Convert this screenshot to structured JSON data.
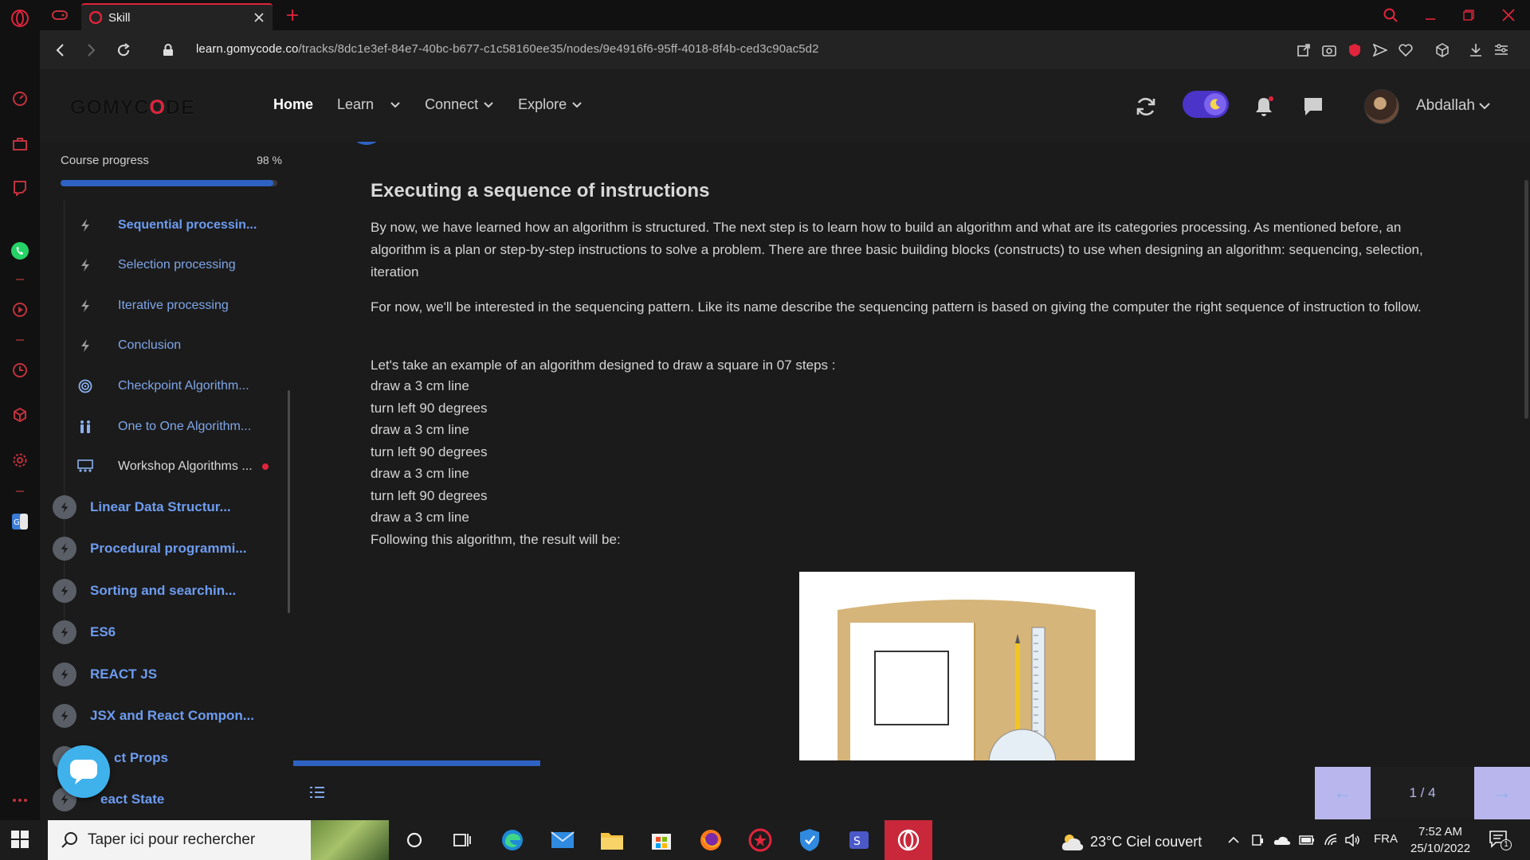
{
  "browser": {
    "tab_title": "Skill",
    "url_host": "learn.gomycode.co",
    "url_path": "/tracks/8dc1e3ef-84e7-40bc-b677-c1c58160ee35/nodes/9e4916f6-95ff-4018-8f4b-ced3c90ac5d2",
    "accent": "#e0243c"
  },
  "header": {
    "logo_pre": "GOMYC",
    "logo_o": "O",
    "logo_post": "DE",
    "nav": [
      {
        "label": "Home"
      },
      {
        "label": "Learn"
      },
      {
        "label": "Connect"
      },
      {
        "label": "Explore"
      }
    ],
    "username": "Abdallah",
    "icons": [
      "refresh-icon",
      "moon-icon",
      "bell-icon",
      "chat-icon"
    ]
  },
  "sidebar": {
    "progress_label": "Course progress",
    "progress_pct": "98 %",
    "progress_value": 0.98,
    "sub_items": [
      {
        "label": "Sequential processin...",
        "icon": "bolt-icon"
      },
      {
        "label": "Selection processing",
        "icon": "bolt-icon"
      },
      {
        "label": "Iterative processing",
        "icon": "bolt-icon"
      },
      {
        "label": "Conclusion",
        "icon": "bolt-icon"
      },
      {
        "label": "Checkpoint Algorithm...",
        "icon": "target-icon"
      },
      {
        "label": "One to One Algorithm...",
        "icon": "people-icon"
      },
      {
        "label": "Workshop Algorithms ...",
        "icon": "workshop-icon"
      }
    ],
    "modules": [
      {
        "label": "Linear Data Structur..."
      },
      {
        "label": "Procedural programmi..."
      },
      {
        "label": "Sorting and searchin..."
      },
      {
        "label": "ES6"
      },
      {
        "label": "REACT JS"
      },
      {
        "label": "JSX and React Compon..."
      },
      {
        "label": "ct Props"
      },
      {
        "label": "eact State"
      }
    ]
  },
  "lesson": {
    "title": "Executing a sequence of instructions",
    "p1": "By now, we have learned how an algorithm is structured. The next step is to learn how to build an algorithm and what are its categories processing. As mentioned before, an algorithm is a plan or step-by-step instructions to solve a problem. There are three basic building blocks (constructs) to use when designing an algorithm: sequencing, selection, iteration",
    "p2": "For now, we'll be interested in the sequencing pattern. Like its name describe the sequencing pattern is based on giving the computer the right sequence of instruction to follow.",
    "intro": "Let's take an example of an algorithm designed to draw a square in 07 steps :",
    "steps": [
      "draw a 3 cm line",
      "turn left 90 degrees",
      "draw a 3 cm line",
      "turn left 90 degrees",
      "draw a 3 cm line",
      "turn left 90 degrees",
      "draw a 3 cm line"
    ],
    "result": "Following this algorithm, the result will be:"
  },
  "pager": {
    "count": "1 / 4",
    "prev_label": "←",
    "next_label": "→"
  },
  "taskbar": {
    "search_placeholder": "Taper ici pour rechercher",
    "weather": "23°C  Ciel couvert",
    "lang": "FRA",
    "time": "7:52 AM",
    "date": "25/10/2022",
    "notif_count": "1"
  }
}
